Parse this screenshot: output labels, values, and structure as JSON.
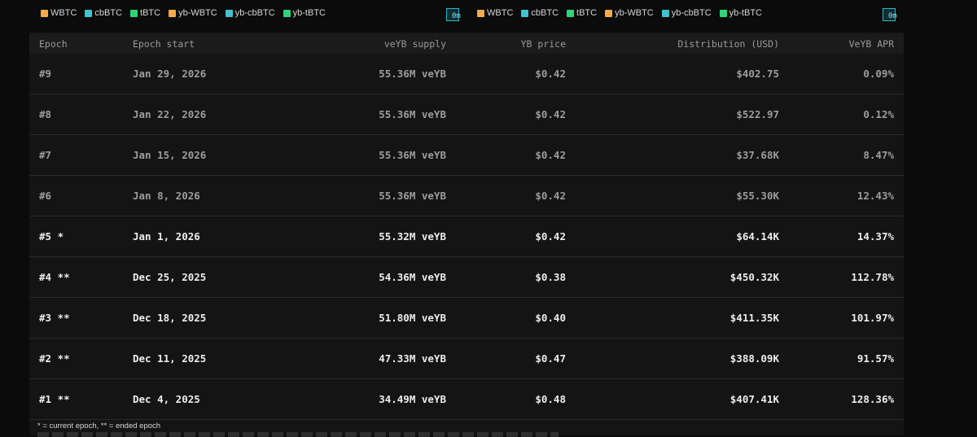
{
  "legend_left": [
    {
      "label": "WBTC",
      "color": "#f5a94a"
    },
    {
      "label": "cbBTC",
      "color": "#3fc3cf"
    },
    {
      "label": "tBTC",
      "color": "#2fd47a"
    },
    {
      "label": "yb-WBTC",
      "color": "#f5a94a"
    },
    {
      "label": "yb-cbBTC",
      "color": "#3fc3cf"
    },
    {
      "label": "yb-tBTC",
      "color": "#2fd47a"
    }
  ],
  "legend_right": [
    {
      "label": "WBTC",
      "color": "#f5a94a"
    },
    {
      "label": "cbBTC",
      "color": "#3fc3cf"
    },
    {
      "label": "tBTC",
      "color": "#2fd47a"
    },
    {
      "label": "yb-WBTC",
      "color": "#f5a94a"
    },
    {
      "label": "yb-cbBTC",
      "color": "#3fc3cf"
    },
    {
      "label": "yb-tBTC",
      "color": "#2fd47a"
    }
  ],
  "mode_button_label": "0m",
  "table": {
    "headers": [
      "Epoch",
      "Epoch start",
      "veYB supply",
      "YB price",
      "Distribution (USD)",
      "VeYB APR"
    ],
    "rows": [
      {
        "epoch": "#9",
        "start": "Jan 29, 2026",
        "supply": "55.36M veYB",
        "price": "$0.42",
        "distribution": "$402.75",
        "apr": "0.09%",
        "state": "future"
      },
      {
        "epoch": "#8",
        "start": "Jan 22, 2026",
        "supply": "55.36M veYB",
        "price": "$0.42",
        "distribution": "$522.97",
        "apr": "0.12%",
        "state": "future"
      },
      {
        "epoch": "#7",
        "start": "Jan 15, 2026",
        "supply": "55.36M veYB",
        "price": "$0.42",
        "distribution": "$37.68K",
        "apr": "8.47%",
        "state": "future"
      },
      {
        "epoch": "#6",
        "start": "Jan 8, 2026",
        "supply": "55.36M veYB",
        "price": "$0.42",
        "distribution": "$55.30K",
        "apr": "12.43%",
        "state": "future"
      },
      {
        "epoch": "#5 *",
        "start": "Jan 1, 2026",
        "supply": "55.32M veYB",
        "price": "$0.42",
        "distribution": "$64.14K",
        "apr": "14.37%",
        "state": "current"
      },
      {
        "epoch": "#4 **",
        "start": "Dec 25, 2025",
        "supply": "54.36M veYB",
        "price": "$0.38",
        "distribution": "$450.32K",
        "apr": "112.78%",
        "state": "ended"
      },
      {
        "epoch": "#3 **",
        "start": "Dec 18, 2025",
        "supply": "51.80M veYB",
        "price": "$0.40",
        "distribution": "$411.35K",
        "apr": "101.97%",
        "state": "ended"
      },
      {
        "epoch": "#2 **",
        "start": "Dec 11, 2025",
        "supply": "47.33M veYB",
        "price": "$0.47",
        "distribution": "$388.09K",
        "apr": "91.57%",
        "state": "ended"
      },
      {
        "epoch": "#1 **",
        "start": "Dec 4, 2025",
        "supply": "34.49M veYB",
        "price": "$0.48",
        "distribution": "$407.41K",
        "apr": "128.36%",
        "state": "ended"
      }
    ]
  },
  "footnote": "* = current epoch, ** = ended epoch"
}
